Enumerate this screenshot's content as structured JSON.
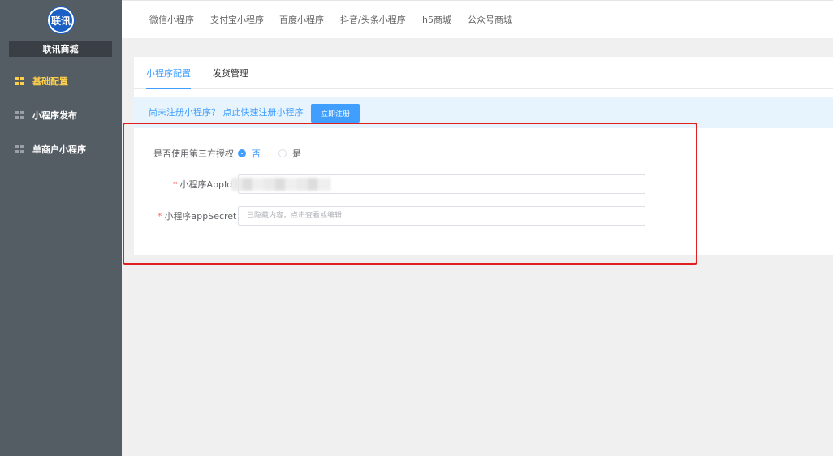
{
  "brand": {
    "logo_text": "联讯",
    "name": "联讯商城"
  },
  "sidebar": {
    "items": [
      {
        "label": "基础配置",
        "icon": "grid-icon",
        "active": true
      },
      {
        "label": "小程序发布",
        "icon": "grid-icon",
        "active": false
      },
      {
        "label": "单商户小程序",
        "icon": "grid-icon",
        "active": false
      }
    ]
  },
  "topbar": {
    "tabs": [
      {
        "label": "微信小程序"
      },
      {
        "label": "支付宝小程序"
      },
      {
        "label": "百度小程序"
      },
      {
        "label": "抖音/头条小程序"
      },
      {
        "label": "h5商城"
      },
      {
        "label": "公众号商城"
      }
    ]
  },
  "content": {
    "tabs": [
      {
        "label": "小程序配置",
        "active": true
      },
      {
        "label": "发货管理",
        "active": false
      }
    ],
    "notice": {
      "text": "尚未注册小程序？ 点此快速注册小程序",
      "button": "立即注册"
    },
    "form": {
      "third_party_auth": {
        "label": "是否使用第三方授权",
        "options": [
          {
            "label": "否",
            "checked": true
          },
          {
            "label": "是",
            "checked": false
          }
        ]
      },
      "appid": {
        "required_mark": "*",
        "label": "小程序AppId",
        "value": ""
      },
      "appsecret": {
        "required_mark": "*",
        "label": "小程序appSecret",
        "placeholder": "已隐藏内容，点击查看或编辑"
      }
    }
  },
  "colors": {
    "sidebar_bg": "#545c64",
    "active_nav": "#ffd04b",
    "primary": "#409eff",
    "annotation": "#e02020"
  }
}
